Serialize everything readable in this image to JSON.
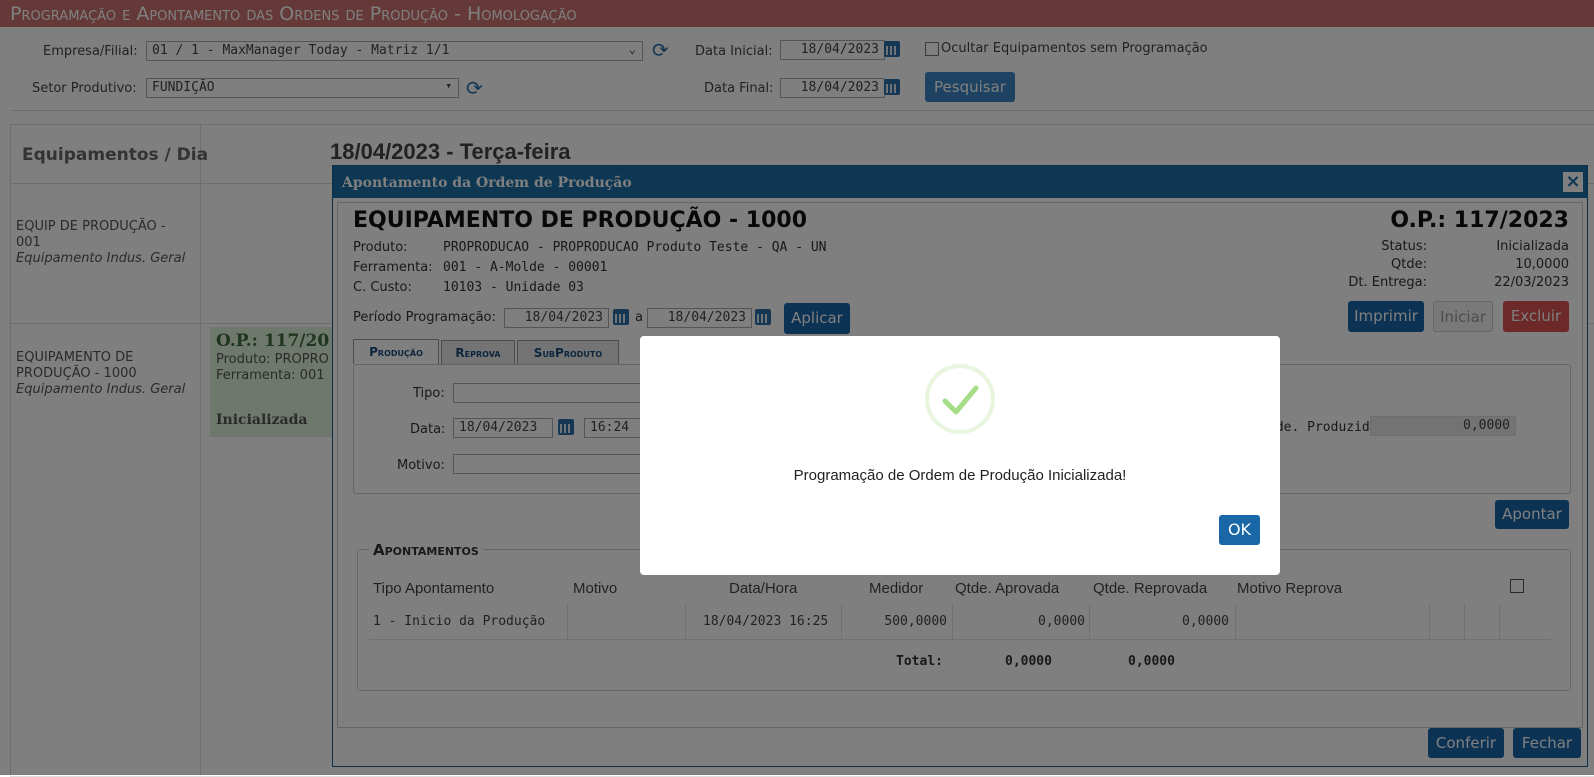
{
  "page": {
    "title": "Programação e Apontamento das Ordens de Produção  - Homologação"
  },
  "filters": {
    "empresa_label": "Empresa/Filial:",
    "empresa_value": "01 / 1 - MaxManager Today - Matriz 1/1",
    "setor_label": "Setor Produtivo:",
    "setor_value": "FUNDIÇÃO",
    "data_inicial_label": "Data Inicial:",
    "data_inicial": "18/04/2023",
    "data_final_label": "Data Final:",
    "data_final": "18/04/2023",
    "ocultar_label": "Ocultar Equipamentos sem Programação",
    "pesquisar": "Pesquisar"
  },
  "schedule": {
    "header": "Equipamentos / Dia",
    "date_title": "18/04/2023 - Terça-feira",
    "equipments": [
      {
        "name": "EQUIP DE PRODUÇÃO - 001",
        "type": "Equipamento Indus. Geral"
      },
      {
        "name": "EQUIPAMENTO DE PRODUÇÃO - 1000",
        "type": "Equipamento Indus. Geral"
      }
    ],
    "card": {
      "op": "O.P.: 117/20",
      "produto": "Produto: PROPRO",
      "ferramenta": "Ferramenta: 001",
      "status": "Inicializada"
    }
  },
  "modal": {
    "title": "Apontamento da Ordem de Produção",
    "close": "×",
    "equipment": "EQUIPAMENTO DE PRODUÇÃO - 1000",
    "op": "O.P.: 117/2023",
    "produto_label": "Produto:",
    "produto": "PROPRODUCAO - PROPRODUCAO Produto Teste - QA - UN",
    "ferramenta_label": "Ferramenta:",
    "ferramenta": "001 - A-Molde - 00001",
    "custo_label": "C. Custo:",
    "custo": "10103 - Unidade 03",
    "status_label": "Status:",
    "status": "Inicializada",
    "qtde_label": "Qtde:",
    "qtde": "10,0000",
    "entrega_label": "Dt. Entrega:",
    "entrega": "22/03/2023",
    "periodo_label": "Período Programação:",
    "periodo_ini": "18/04/2023",
    "periodo_a": "a",
    "periodo_fim": "18/04/2023",
    "aplicar": "Aplicar",
    "imprimir": "Imprimir",
    "iniciar": "Iniciar",
    "excluir": "Excluir",
    "tabs": [
      "Produção",
      "Reprova",
      "SubProduto"
    ],
    "tipo_label": "Tipo:",
    "data_label": "Data:",
    "data_value": "18/04/2023",
    "hora_value": "16:24",
    "motivo_label": "Motivo:",
    "qtde_produzida_label": "tde. Produzida:",
    "qtde_produzida": "0,0000",
    "apontar": "Apontar",
    "apontamentos_title": "Apontamentos",
    "columns": [
      "Tipo Apontamento",
      "Motivo",
      "Data/Hora",
      "Medidor",
      "Qtde. Aprovada",
      "Qtde. Reprovada",
      "Motivo Reprova"
    ],
    "rows": [
      {
        "tipo": "1 - Inicio da Produção",
        "motivo": "",
        "datahora": "18/04/2023 16:25",
        "medidor": "500,0000",
        "aprovada": "0,0000",
        "reprovada": "0,0000",
        "motivo_reprova": ""
      }
    ],
    "total_label": "Total:",
    "total_aprovada": "0,0000",
    "total_reprovada": "0,0000",
    "conferir": "Conferir",
    "fechar": "Fechar"
  },
  "alert": {
    "message": "Programação de Ordem de Produção Inicializada!",
    "ok": "OK"
  },
  "colors": {
    "primary": "#1a67a8",
    "danger": "#d9534f",
    "success": "#a5dc86",
    "header": "#c8736f"
  }
}
